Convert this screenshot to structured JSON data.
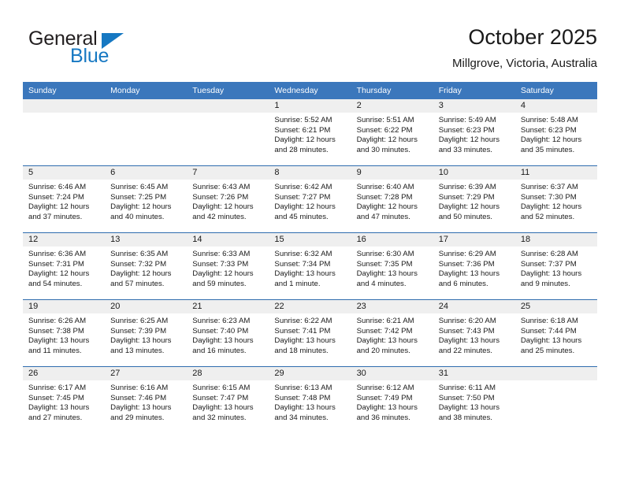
{
  "brand": {
    "line1": "General",
    "line2": "Blue",
    "triangle_color": "#1678c2",
    "text_color": "#231f20"
  },
  "header": {
    "title": "October 2025",
    "location": "Millgrove, Victoria, Australia"
  },
  "colors": {
    "header_blue": "#3b77bc",
    "row_divider": "#2f6cae",
    "daynum_strip": "#efefef",
    "text": "#1a1a1a"
  },
  "weekday_headers": [
    "Sunday",
    "Monday",
    "Tuesday",
    "Wednesday",
    "Thursday",
    "Friday",
    "Saturday"
  ],
  "weeks": [
    [
      {
        "day": "",
        "empty": true,
        "lines": []
      },
      {
        "day": "",
        "empty": true,
        "lines": []
      },
      {
        "day": "",
        "empty": true,
        "lines": []
      },
      {
        "day": "1",
        "empty": false,
        "lines": [
          "Sunrise: 5:52 AM",
          "Sunset: 6:21 PM",
          "Daylight: 12 hours",
          "and 28 minutes."
        ]
      },
      {
        "day": "2",
        "empty": false,
        "lines": [
          "Sunrise: 5:51 AM",
          "Sunset: 6:22 PM",
          "Daylight: 12 hours",
          "and 30 minutes."
        ]
      },
      {
        "day": "3",
        "empty": false,
        "lines": [
          "Sunrise: 5:49 AM",
          "Sunset: 6:23 PM",
          "Daylight: 12 hours",
          "and 33 minutes."
        ]
      },
      {
        "day": "4",
        "empty": false,
        "lines": [
          "Sunrise: 5:48 AM",
          "Sunset: 6:23 PM",
          "Daylight: 12 hours",
          "and 35 minutes."
        ]
      }
    ],
    [
      {
        "day": "5",
        "empty": false,
        "lines": [
          "Sunrise: 6:46 AM",
          "Sunset: 7:24 PM",
          "Daylight: 12 hours",
          "and 37 minutes."
        ]
      },
      {
        "day": "6",
        "empty": false,
        "lines": [
          "Sunrise: 6:45 AM",
          "Sunset: 7:25 PM",
          "Daylight: 12 hours",
          "and 40 minutes."
        ]
      },
      {
        "day": "7",
        "empty": false,
        "lines": [
          "Sunrise: 6:43 AM",
          "Sunset: 7:26 PM",
          "Daylight: 12 hours",
          "and 42 minutes."
        ]
      },
      {
        "day": "8",
        "empty": false,
        "lines": [
          "Sunrise: 6:42 AM",
          "Sunset: 7:27 PM",
          "Daylight: 12 hours",
          "and 45 minutes."
        ]
      },
      {
        "day": "9",
        "empty": false,
        "lines": [
          "Sunrise: 6:40 AM",
          "Sunset: 7:28 PM",
          "Daylight: 12 hours",
          "and 47 minutes."
        ]
      },
      {
        "day": "10",
        "empty": false,
        "lines": [
          "Sunrise: 6:39 AM",
          "Sunset: 7:29 PM",
          "Daylight: 12 hours",
          "and 50 minutes."
        ]
      },
      {
        "day": "11",
        "empty": false,
        "lines": [
          "Sunrise: 6:37 AM",
          "Sunset: 7:30 PM",
          "Daylight: 12 hours",
          "and 52 minutes."
        ]
      }
    ],
    [
      {
        "day": "12",
        "empty": false,
        "lines": [
          "Sunrise: 6:36 AM",
          "Sunset: 7:31 PM",
          "Daylight: 12 hours",
          "and 54 minutes."
        ]
      },
      {
        "day": "13",
        "empty": false,
        "lines": [
          "Sunrise: 6:35 AM",
          "Sunset: 7:32 PM",
          "Daylight: 12 hours",
          "and 57 minutes."
        ]
      },
      {
        "day": "14",
        "empty": false,
        "lines": [
          "Sunrise: 6:33 AM",
          "Sunset: 7:33 PM",
          "Daylight: 12 hours",
          "and 59 minutes."
        ]
      },
      {
        "day": "15",
        "empty": false,
        "lines": [
          "Sunrise: 6:32 AM",
          "Sunset: 7:34 PM",
          "Daylight: 13 hours",
          "and 1 minute."
        ]
      },
      {
        "day": "16",
        "empty": false,
        "lines": [
          "Sunrise: 6:30 AM",
          "Sunset: 7:35 PM",
          "Daylight: 13 hours",
          "and 4 minutes."
        ]
      },
      {
        "day": "17",
        "empty": false,
        "lines": [
          "Sunrise: 6:29 AM",
          "Sunset: 7:36 PM",
          "Daylight: 13 hours",
          "and 6 minutes."
        ]
      },
      {
        "day": "18",
        "empty": false,
        "lines": [
          "Sunrise: 6:28 AM",
          "Sunset: 7:37 PM",
          "Daylight: 13 hours",
          "and 9 minutes."
        ]
      }
    ],
    [
      {
        "day": "19",
        "empty": false,
        "lines": [
          "Sunrise: 6:26 AM",
          "Sunset: 7:38 PM",
          "Daylight: 13 hours",
          "and 11 minutes."
        ]
      },
      {
        "day": "20",
        "empty": false,
        "lines": [
          "Sunrise: 6:25 AM",
          "Sunset: 7:39 PM",
          "Daylight: 13 hours",
          "and 13 minutes."
        ]
      },
      {
        "day": "21",
        "empty": false,
        "lines": [
          "Sunrise: 6:23 AM",
          "Sunset: 7:40 PM",
          "Daylight: 13 hours",
          "and 16 minutes."
        ]
      },
      {
        "day": "22",
        "empty": false,
        "lines": [
          "Sunrise: 6:22 AM",
          "Sunset: 7:41 PM",
          "Daylight: 13 hours",
          "and 18 minutes."
        ]
      },
      {
        "day": "23",
        "empty": false,
        "lines": [
          "Sunrise: 6:21 AM",
          "Sunset: 7:42 PM",
          "Daylight: 13 hours",
          "and 20 minutes."
        ]
      },
      {
        "day": "24",
        "empty": false,
        "lines": [
          "Sunrise: 6:20 AM",
          "Sunset: 7:43 PM",
          "Daylight: 13 hours",
          "and 22 minutes."
        ]
      },
      {
        "day": "25",
        "empty": false,
        "lines": [
          "Sunrise: 6:18 AM",
          "Sunset: 7:44 PM",
          "Daylight: 13 hours",
          "and 25 minutes."
        ]
      }
    ],
    [
      {
        "day": "26",
        "empty": false,
        "lines": [
          "Sunrise: 6:17 AM",
          "Sunset: 7:45 PM",
          "Daylight: 13 hours",
          "and 27 minutes."
        ]
      },
      {
        "day": "27",
        "empty": false,
        "lines": [
          "Sunrise: 6:16 AM",
          "Sunset: 7:46 PM",
          "Daylight: 13 hours",
          "and 29 minutes."
        ]
      },
      {
        "day": "28",
        "empty": false,
        "lines": [
          "Sunrise: 6:15 AM",
          "Sunset: 7:47 PM",
          "Daylight: 13 hours",
          "and 32 minutes."
        ]
      },
      {
        "day": "29",
        "empty": false,
        "lines": [
          "Sunrise: 6:13 AM",
          "Sunset: 7:48 PM",
          "Daylight: 13 hours",
          "and 34 minutes."
        ]
      },
      {
        "day": "30",
        "empty": false,
        "lines": [
          "Sunrise: 6:12 AM",
          "Sunset: 7:49 PM",
          "Daylight: 13 hours",
          "and 36 minutes."
        ]
      },
      {
        "day": "31",
        "empty": false,
        "lines": [
          "Sunrise: 6:11 AM",
          "Sunset: 7:50 PM",
          "Daylight: 13 hours",
          "and 38 minutes."
        ]
      },
      {
        "day": "",
        "empty": true,
        "lines": []
      }
    ]
  ]
}
